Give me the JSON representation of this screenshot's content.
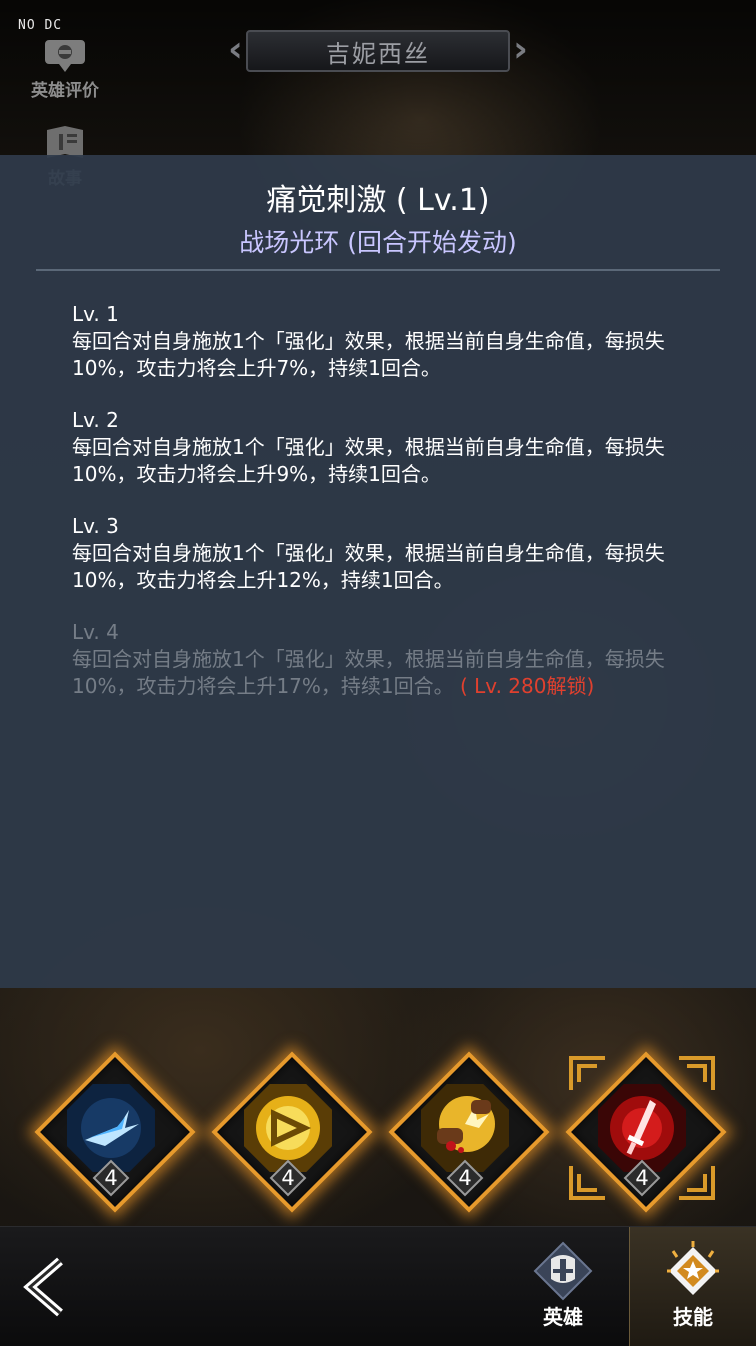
{
  "debug": {
    "tag": "NO DC"
  },
  "header": {
    "hero_name": "吉妮西丝",
    "side_buttons": [
      {
        "label": "英雄评价",
        "icon": "chat-bubble-icon"
      },
      {
        "label": "故事",
        "icon": "book-icon"
      }
    ]
  },
  "skill_panel": {
    "title": "痛觉刺激 ( Lv.1)",
    "subtitle": "战场光环 (回合开始发动)",
    "levels": [
      {
        "head": "Lv. 1",
        "desc": "每回合对自身施放1个「强化」效果，根据当前自身生命值，每损失10%，攻击力将会上升7%，持续1回合。",
        "locked": false,
        "unlock": ""
      },
      {
        "head": "Lv. 2",
        "desc": "每回合对自身施放1个「强化」效果，根据当前自身生命值，每损失10%，攻击力将会上升9%，持续1回合。",
        "locked": false,
        "unlock": ""
      },
      {
        "head": "Lv. 3",
        "desc": "每回合对自身施放1个「强化」效果，根据当前自身生命值，每损失10%，攻击力将会上升12%，持续1回合。",
        "locked": false,
        "unlock": ""
      },
      {
        "head": "Lv. 4",
        "desc": "每回合对自身施放1个「强化」效果，根据当前自身生命值，每损失10%，攻击力将会上升17%，持续1回合。",
        "locked": true,
        "unlock": " ( Lv. 280解锁)"
      }
    ]
  },
  "skills": [
    {
      "icon": "ice-blade-icon",
      "level": "4",
      "selected": false,
      "color": "#3aa0e8"
    },
    {
      "icon": "golden-triangle-icon",
      "level": "4",
      "selected": false,
      "color": "#f0c020"
    },
    {
      "icon": "fist-strike-icon",
      "level": "4",
      "selected": false,
      "color": "#e8b020"
    },
    {
      "icon": "blood-sword-icon",
      "level": "4",
      "selected": true,
      "color": "#d01818"
    }
  ],
  "bottom_nav": {
    "back_icon": "back-arrow-icon",
    "tabs": [
      {
        "label": "英雄",
        "icon": "helmet-icon",
        "active": false
      },
      {
        "label": "技能",
        "icon": "skill-badge-icon",
        "active": true
      }
    ]
  },
  "colors": {
    "panel_bg": "#2e3a4a",
    "subtitle": "#c9c6ff",
    "locked_text": "#757d87",
    "unlock_text": "#e0402e",
    "accent_orange": "#e79a2c"
  }
}
